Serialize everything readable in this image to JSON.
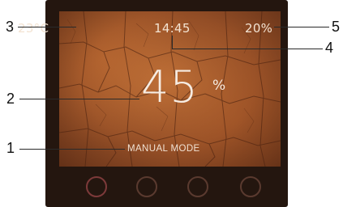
{
  "display": {
    "temperature": "23°C",
    "clock": "14:45",
    "battery": "20%",
    "main_value": "45",
    "main_unit": "%",
    "mode": "MANUAL MODE"
  },
  "callouts": [
    "1",
    "2",
    "3",
    "4",
    "5"
  ],
  "controls": {
    "buttons": [
      "control-button-1",
      "control-button-2",
      "control-button-3",
      "control-button-4"
    ]
  },
  "colors": {
    "device_frame": "#24160f",
    "screen_background": "#93512a",
    "display_text": "#f3e3d2",
    "button_ring": "#6c3733"
  }
}
